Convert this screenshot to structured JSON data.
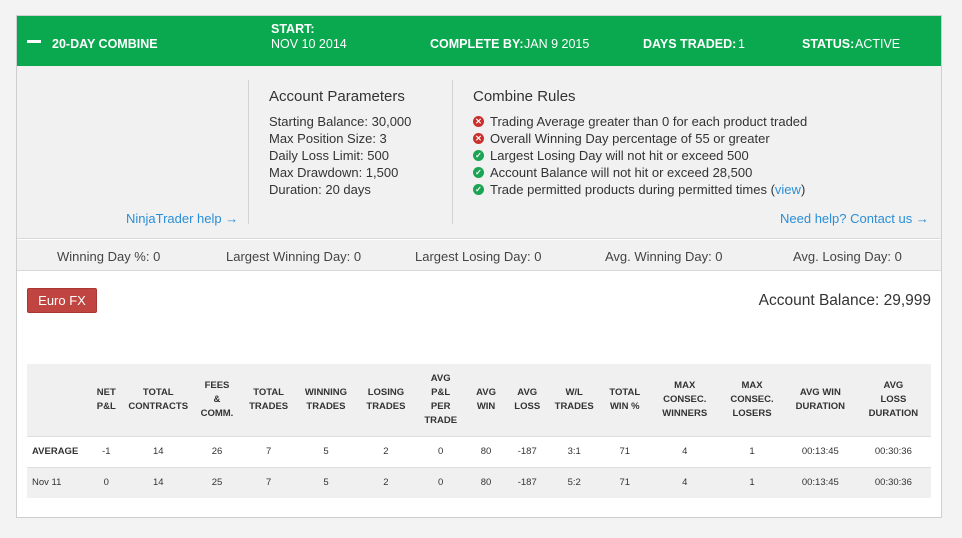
{
  "header": {
    "title": "20-DAY COMBINE",
    "start_label": "START:",
    "start_value": "NOV 10 2014",
    "complete_label": "COMPLETE BY:",
    "complete_value": "JAN 9 2015",
    "days_label": "DAYS TRADED:",
    "days_value": "1",
    "status_label": "STATUS:",
    "status_value": "ACTIVE",
    "bg_color": "#0aa84f"
  },
  "help_link": "NinjaTrader help →",
  "account_parameters": {
    "title": "Account Parameters",
    "items": [
      "Starting Balance: 30,000",
      "Max Position Size: 3",
      "Daily Loss Limit: 500",
      "Max Drawdown: 1,500",
      "Duration: 20 days"
    ]
  },
  "combine_rules": {
    "title": "Combine Rules",
    "items": [
      {
        "text": "Trading Average greater than 0 for each product traded",
        "status": "fail",
        "icon": "x-circle-icon"
      },
      {
        "text": "Overall Winning Day percentage of 55 or greater",
        "status": "fail",
        "icon": "x-circle-icon"
      },
      {
        "text": "Largest Losing Day will not hit or exceed 500",
        "status": "pass",
        "icon": "check-circle-icon"
      },
      {
        "text": "Account Balance will not hit or exceed 28,500",
        "status": "pass",
        "icon": "check-circle-icon"
      },
      {
        "text": "Trade permitted products during permitted times (",
        "link": "view",
        "suffix": ")",
        "status": "pass",
        "icon": "check-circle-icon"
      }
    ],
    "contact_link": "Need help? Contact us →"
  },
  "stats": {
    "winning_day_pct": "Winning Day %: 0",
    "largest_winning_day": "Largest Winning Day: 0",
    "largest_losing_day": "Largest Losing Day: 0",
    "avg_winning_day": "Avg. Winning Day: 0",
    "avg_losing_day": "Avg. Losing Day: 0"
  },
  "product_button": "Euro FX",
  "account_balance": "Account Balance: 29,999",
  "table": {
    "columns": [
      [
        ""
      ],
      [
        "NET",
        "P&L"
      ],
      [
        "TOTAL",
        "CONTRACTS"
      ],
      [
        "FEES",
        "&",
        "COMM."
      ],
      [
        "TOTAL",
        "TRADES"
      ],
      [
        "WINNING",
        "TRADES"
      ],
      [
        "LOSING",
        "TRADES"
      ],
      [
        "AVG",
        "P&L",
        "PER",
        "TRADE"
      ],
      [
        "AVG",
        "WIN"
      ],
      [
        "AVG",
        "LOSS"
      ],
      [
        "W/L",
        "TRADES"
      ],
      [
        "TOTAL",
        "WIN %"
      ],
      [
        "MAX",
        "CONSEC.",
        "WINNERS"
      ],
      [
        "MAX",
        "CONSEC.",
        "LOSERS"
      ],
      [
        "AVG WIN",
        "DURATION"
      ],
      [
        "AVG",
        "LOSS",
        "DURATION"
      ]
    ],
    "rows": [
      [
        "AVERAGE",
        "-1",
        "14",
        "26",
        "7",
        "5",
        "2",
        "0",
        "80",
        "-187",
        "3:1",
        "71",
        "4",
        "1",
        "00:13:45",
        "00:30:36"
      ],
      [
        "Nov 11",
        "0",
        "14",
        "25",
        "7",
        "5",
        "2",
        "0",
        "80",
        "-187",
        "5:2",
        "71",
        "4",
        "1",
        "00:13:45",
        "00:30:36"
      ]
    ]
  }
}
